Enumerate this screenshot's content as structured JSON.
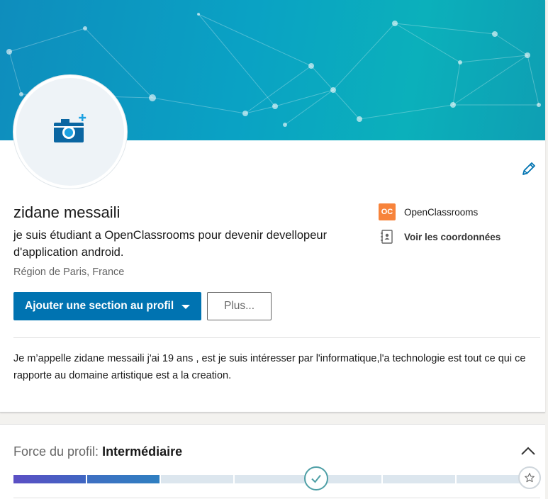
{
  "profile": {
    "name": "zidane messaili",
    "headline": "je suis étudiant a OpenClassrooms pour devenir devellopeur d'application android.",
    "location": "Région de Paris, France",
    "summary": "Je m’appelle zidane messaili j'ai 19 ans , est je suis intéresser par l'informatique,l'a technologie est tout ce qui ce rapporte au domaine artistique est a la creation.",
    "avatar_icon": "camera-add-icon",
    "edit_icon": "pencil-icon"
  },
  "right_links": {
    "school_label": "OpenClassrooms",
    "school_logo_text": "OC",
    "contact_label": "Voir les coordonnées"
  },
  "actions": {
    "add_section_label": "Ajouter une section au profil",
    "more_label": "Plus..."
  },
  "strength": {
    "title_prefix": "Force du profil: ",
    "level": "Intermédiaire",
    "completed_steps": 2,
    "total_steps": 7
  },
  "colors": {
    "primary": "#0073b1",
    "meter_fill_start": "#5b4fc4",
    "meter_fill_end": "#2f7fc1",
    "meter_empty": "#dce6ee",
    "oc_brand": "#f7833b",
    "checkpoint": "#4e9fa6"
  }
}
